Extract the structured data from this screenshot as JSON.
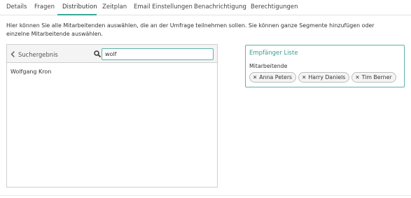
{
  "tabs": [
    {
      "label": "Details",
      "active": false
    },
    {
      "label": "Fragen",
      "active": false
    },
    {
      "label": "Distribution",
      "active": true
    },
    {
      "label": "Zeitplan",
      "active": false
    },
    {
      "label": "Email Einstellungen",
      "active": false
    },
    {
      "label": "Benachrichtigung",
      "active": false
    },
    {
      "label": "Berechtigungen",
      "active": false
    }
  ],
  "intro": {
    "text": "Hier können Sie alle Mitarbeitenden auswählen, die an der Umfrage teilnehmen sollen. Sie können ganze Segmente hinzufügen oder einzelne Mitarbeitende auswählen."
  },
  "search_panel": {
    "back_label": "Suchergebnis",
    "back_icon": "chevron-left-icon",
    "search_icon": "search-icon",
    "query": "wolf",
    "results": [
      "Wolfgang Kron"
    ]
  },
  "recipients": {
    "title": "Empfänger Liste",
    "subtitle": "Mitarbeitende",
    "remove_icon": "close-icon",
    "chips": [
      "Anna Peters",
      "Harry Daniels",
      "Tim Berner"
    ]
  },
  "colors": {
    "accent": "#3aa89b",
    "border": "#cfcfcf",
    "text": "#333333"
  }
}
